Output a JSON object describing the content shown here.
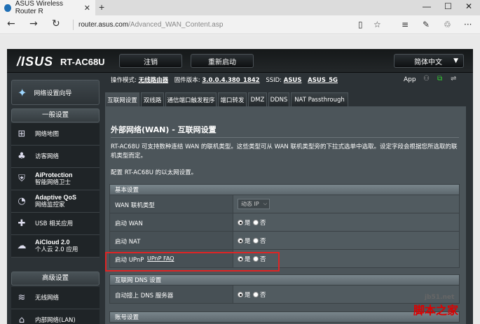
{
  "browser": {
    "tab_title": "ASUS Wireless Router R",
    "tab_close": "✕",
    "new_tab": "+",
    "url_host": "router.asus.com",
    "url_path": "/Advanced_WAN_Content.asp",
    "back": "←",
    "forward": "→",
    "refresh": "↻"
  },
  "router": {
    "logo": "/ISUS",
    "model": "RT-AC68U",
    "logout": "注销",
    "reboot": "重新启动",
    "language": "简体中文",
    "status": {
      "mode_label": "操作模式:",
      "mode_value": "无线路由器",
      "fw_label": "固件版本:",
      "fw_value": "3.0.0.4.380_1842",
      "ssid_label": "SSID:",
      "ssid_1": "ASUS",
      "ssid_2": "ASUS_5G",
      "app": "App"
    },
    "qis": "网络设置向导",
    "general_header": "一般设置",
    "general_items": [
      {
        "label": "网络地图",
        "icon": "network-map-icon"
      },
      {
        "label": "访客网络",
        "icon": "guest-network-icon"
      },
      {
        "label_main": "AiProtection",
        "label_sub": "智能网络卫士",
        "icon": "aiprotection-icon"
      },
      {
        "label_main": "Adaptive QoS",
        "label_sub": "网络监控家",
        "icon": "qos-icon"
      },
      {
        "label": "USB 相关应用",
        "icon": "usb-icon"
      },
      {
        "label_main": "AiCloud 2.0",
        "label_sub": "个人云 2.0 应用",
        "icon": "cloud-icon"
      }
    ],
    "advanced_header": "高级设置",
    "advanced_items": [
      {
        "label": "无线网络",
        "icon": "wireless-icon"
      },
      {
        "label": "内部网络(LAN)",
        "icon": "lan-icon"
      }
    ],
    "tabs": [
      "互联网设置",
      "双线路",
      "通信端口触发程序",
      "端口转发",
      "DMZ",
      "DDNS",
      "NAT Passthrough"
    ],
    "panel": {
      "title": "外部网络(WAN) - 互联网设置",
      "desc": "RT-AC68U 可支持数种连结 WAN 的联机类型。这些类型可从 WAN 联机类型旁的下拉式选单中选取。设定字段会根据您所选取的联机类型而定。",
      "configure": "配置 RT-AC68U 的以太网设置。",
      "basic_header": "基本设置",
      "rows": [
        {
          "label": "WAN 联机类型",
          "select": "动态 IP"
        },
        {
          "label": "启动 WAN",
          "yes": "是",
          "no": "否"
        },
        {
          "label": "启动 NAT",
          "yes": "是",
          "no": "否"
        },
        {
          "label": "启动 UPnP",
          "link": "UPnP FAQ",
          "yes": "是",
          "no": "否"
        }
      ],
      "dns_header": "互联网 DNS 设置",
      "dns_row": {
        "label": "自动接上 DNS 服务器",
        "yes": "是",
        "no": "否"
      },
      "account_header": "账号设置"
    }
  },
  "watermark": {
    "main": "脚本之家",
    "sub": "jb51.net"
  }
}
